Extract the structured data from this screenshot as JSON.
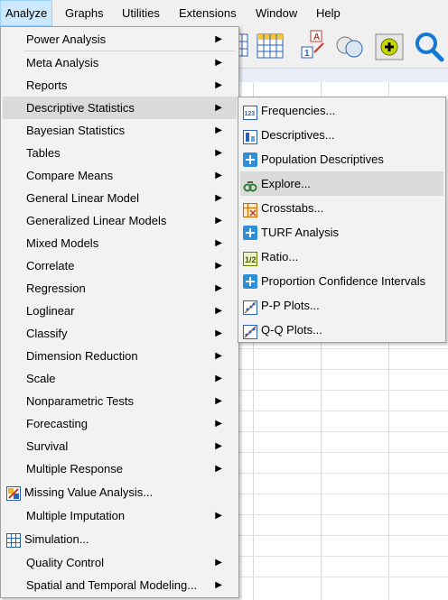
{
  "menubar": {
    "items": [
      {
        "label": "Analyze"
      },
      {
        "label": "Graphs"
      },
      {
        "label": "Utilities"
      },
      {
        "label": "Extensions"
      },
      {
        "label": "Window"
      },
      {
        "label": "Help"
      }
    ]
  },
  "analyze_menu": {
    "items": [
      {
        "label": "Power Analysis"
      },
      {
        "label": "Meta Analysis"
      },
      {
        "label": "Reports"
      },
      {
        "label": "Descriptive Statistics"
      },
      {
        "label": "Bayesian Statistics"
      },
      {
        "label": "Tables"
      },
      {
        "label": "Compare Means"
      },
      {
        "label": "General Linear Model"
      },
      {
        "label": "Generalized Linear Models"
      },
      {
        "label": "Mixed Models"
      },
      {
        "label": "Correlate"
      },
      {
        "label": "Regression"
      },
      {
        "label": "Loglinear"
      },
      {
        "label": "Classify"
      },
      {
        "label": "Dimension Reduction"
      },
      {
        "label": "Scale"
      },
      {
        "label": "Nonparametric Tests"
      },
      {
        "label": "Forecasting"
      },
      {
        "label": "Survival"
      },
      {
        "label": "Multiple Response"
      },
      {
        "label": "Missing Value Analysis..."
      },
      {
        "label": "Multiple Imputation"
      },
      {
        "label": "Simulation..."
      },
      {
        "label": "Quality Control"
      },
      {
        "label": "Spatial and Temporal Modeling..."
      }
    ]
  },
  "descriptive_submenu": {
    "items": [
      {
        "label": "Frequencies...",
        "icon": "frequencies-icon"
      },
      {
        "label": "Descriptives...",
        "icon": "descriptives-icon"
      },
      {
        "label": "Population Descriptives",
        "icon": "plus-box-icon"
      },
      {
        "label": "Explore...",
        "icon": "explore-icon"
      },
      {
        "label": "Crosstabs...",
        "icon": "crosstabs-icon"
      },
      {
        "label": "TURF Analysis",
        "icon": "plus-box-icon"
      },
      {
        "label": "Ratio...",
        "icon": "ratio-icon"
      },
      {
        "label": "Proportion Confidence Intervals",
        "icon": "plus-box-icon"
      },
      {
        "label": "P-P Plots...",
        "icon": "pp-plot-icon"
      },
      {
        "label": "Q-Q Plots...",
        "icon": "qq-plot-icon"
      }
    ]
  },
  "toolbar": {
    "icons": [
      "data-editor-icon",
      "table-icon",
      "variable-sort-icon",
      "select-cases-icon",
      "value-labels-icon",
      "search-icon"
    ]
  }
}
